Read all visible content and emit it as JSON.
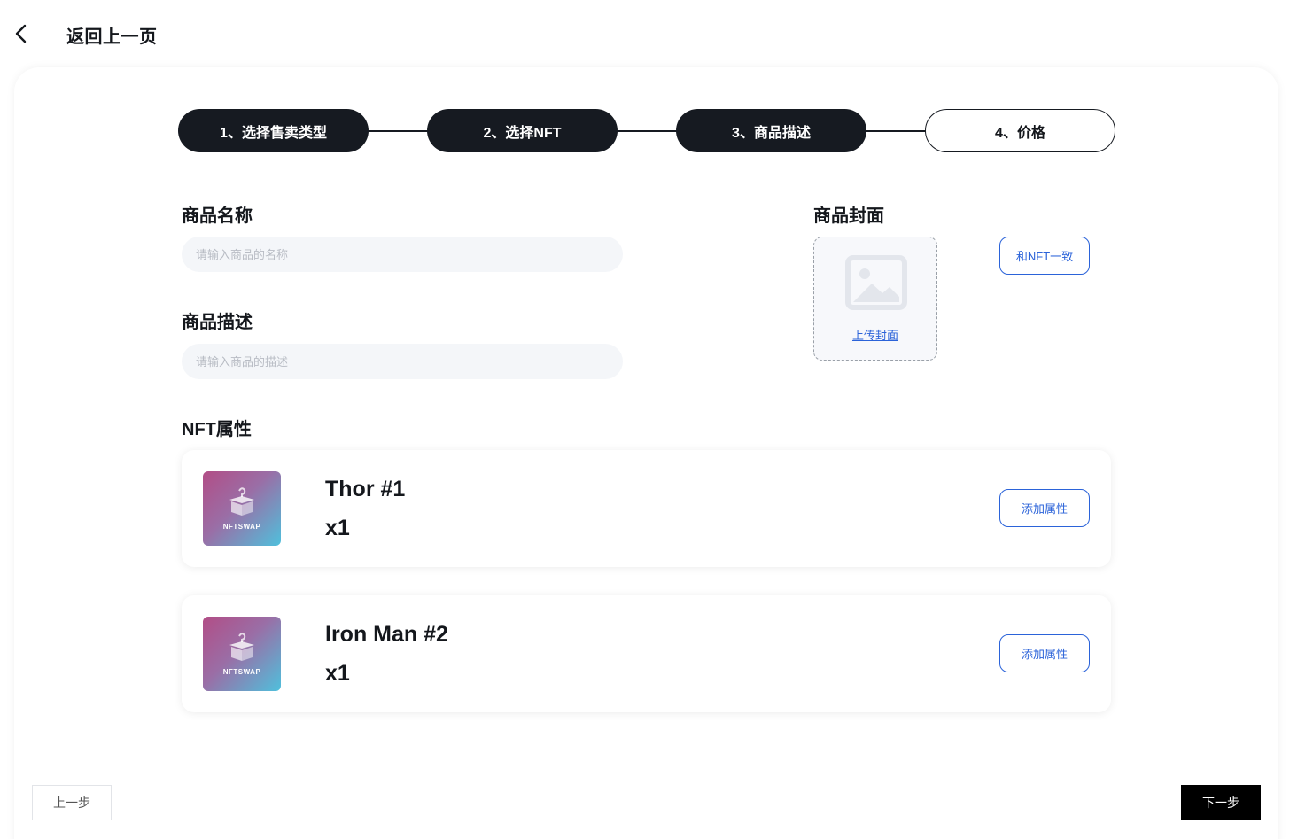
{
  "header": {
    "back_icon": "chevron-left-icon",
    "title": "返回上一页"
  },
  "steps": [
    {
      "label": "1、选择售卖类型",
      "status": "done"
    },
    {
      "label": "2、选择NFT",
      "status": "done"
    },
    {
      "label": "3、商品描述",
      "status": "done"
    },
    {
      "label": "4、价格",
      "status": "current"
    }
  ],
  "form": {
    "name_label": "商品名称",
    "name_placeholder": "请输入商品的名称",
    "name_value": "",
    "desc_label": "商品描述",
    "desc_placeholder": "请输入商品的描述",
    "desc_value": "",
    "cover_label": "商品封面",
    "cover_upload_label": "上传封面",
    "cover_icon": "image-placeholder-icon",
    "same_as_nft_label": "和NFT一致"
  },
  "nft_section": {
    "label": "NFT属性",
    "items": [
      {
        "name": "Thor #1",
        "quantity": "x1",
        "thumb_brand": "NFTSWAP",
        "thumb_icon": "box-icon",
        "add_attr_label": "添加属性"
      },
      {
        "name": "Iron Man #2",
        "quantity": "x1",
        "thumb_brand": "NFTSWAP",
        "thumb_icon": "box-icon",
        "add_attr_label": "添加属性"
      }
    ]
  },
  "footer": {
    "prev_label": "上一步",
    "next_label": "下一步"
  },
  "colors": {
    "dark": "#161a21",
    "accent": "#2b63d9",
    "input_bg": "#f4f6f9"
  }
}
